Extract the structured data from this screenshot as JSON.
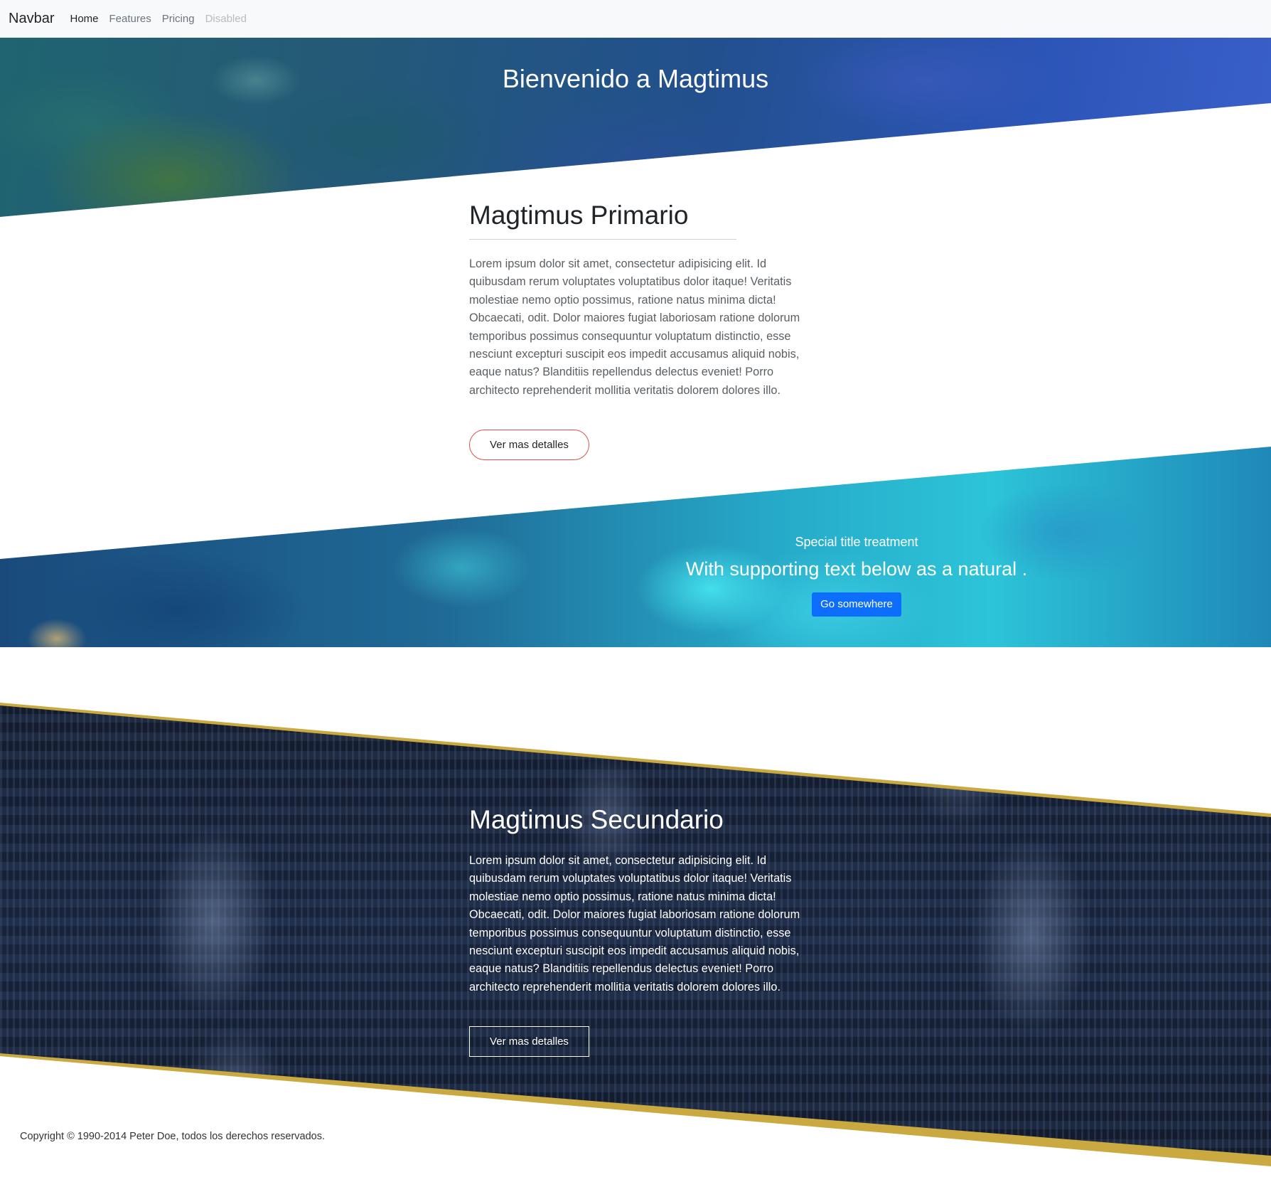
{
  "navbar": {
    "brand": "Navbar",
    "links": [
      {
        "label": "Home",
        "state": "active"
      },
      {
        "label": "Features",
        "state": "normal"
      },
      {
        "label": "Pricing",
        "state": "normal"
      },
      {
        "label": "Disabled",
        "state": "disabled"
      }
    ]
  },
  "hero": {
    "title": "Bienvenido a Magtimus"
  },
  "primary": {
    "title": "Magtimus Primario",
    "body": "Lorem ipsum dolor sit amet, consectetur adipisicing elit. Id quibusdam rerum voluptates voluptatibus dolor itaque! Veritatis molestiae nemo optio possimus, ratione natus minima dicta! Obcaecati, odit. Dolor maiores fugiat laboriosam ratione dolorum temporibus possimus consequuntur voluptatum distinctio, esse nesciunt excepturi suscipit eos impedit accusamus aliquid nobis, eaque natus? Blanditiis repellendus delectus eveniet! Porro architecto reprehenderit mollitia veritatis dolorem dolores illo.",
    "button": "Ver mas detalles"
  },
  "band": {
    "subtitle": "Special title treatment",
    "title": "With supporting text below as a natural .",
    "button": "Go somewhere"
  },
  "secondary": {
    "title": "Magtimus Secundario",
    "body": "Lorem ipsum dolor sit amet, consectetur adipisicing elit. Id quibusdam rerum voluptates voluptatibus dolor itaque! Veritatis molestiae nemo optio possimus, ratione natus minima dicta! Obcaecati, odit. Dolor maiores fugiat laboriosam ratione dolorum temporibus possimus consequuntur voluptatum distinctio, esse nesciunt excepturi suscipit eos impedit accusamus aliquid nobis, eaque natus? Blanditiis repellendus delectus eveniet! Porro architecto reprehenderit mollitia veritatis dolorem dolores illo.",
    "button": "Ver mas detalles"
  },
  "footer": {
    "copyright": "Copyright © 1990-2014 Peter Doe, todos los derechos reservados."
  },
  "colors": {
    "navbar_bg": "#f8f9fa",
    "primary_button": "#0d6efd",
    "outline_button_border": "#d9534f",
    "dark_section_border": "#c9a940"
  }
}
